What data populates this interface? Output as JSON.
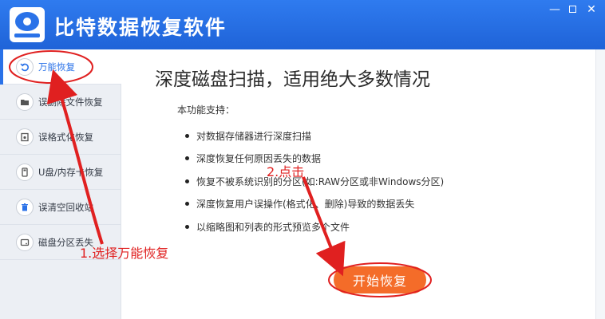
{
  "app": {
    "title": "比特数据恢复软件",
    "window_controls": {
      "minimize": "—",
      "close": "✕"
    }
  },
  "sidebar": {
    "items": [
      {
        "label": "万能恢复",
        "icon": "undo-icon",
        "active": true
      },
      {
        "label": "误删除文件恢复",
        "icon": "folder-icon",
        "active": false
      },
      {
        "label": "误格式化恢复",
        "icon": "format-disk-icon",
        "active": false
      },
      {
        "label": "U盘/内存卡恢复",
        "icon": "usb-drive-icon",
        "active": false
      },
      {
        "label": "误清空回收站",
        "icon": "trash-icon",
        "active": false
      },
      {
        "label": "磁盘分区丢失",
        "icon": "hard-disk-icon",
        "active": false
      }
    ]
  },
  "main": {
    "title": "深度磁盘扫描，适用绝大多数情况",
    "feature_heading": "本功能支持：",
    "features": [
      "对数据存储器进行深度扫描",
      "深度恢复任何原因丢失的数据",
      "恢复不被系统识别的分区(如:RAW分区或非Windows分区)",
      "深度恢复用户误操作(格式化、删除)导致的数据丢失",
      "以缩略图和列表的形式预览多个文件"
    ],
    "start_button": "开始恢复"
  },
  "annotations": {
    "step1": "1.选择万能恢复",
    "step2": "2.点击",
    "color": "#e02020"
  },
  "colors": {
    "titlebar": "#2a72e8",
    "accent": "#2a72e8",
    "start_button": "#f46c29"
  }
}
